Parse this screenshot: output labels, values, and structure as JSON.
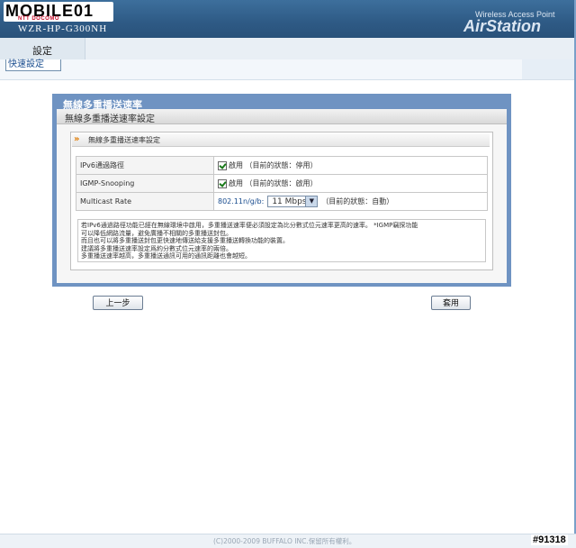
{
  "header": {
    "logo_text": "MOBILE01",
    "logo_sub": "NTT DOCOMO",
    "model": "WZR-HP-G300NH",
    "product_line": "Wireless Access Point",
    "brand": "AirStation"
  },
  "nav": {
    "tab_settings": "設定",
    "quick_setup": "快速設定"
  },
  "panel": {
    "title": "無線多重播送速率",
    "subtitle": "無線多重播送速率設定",
    "section_title": "無線多重播送速率設定",
    "rows": [
      {
        "label": "IPv6通過路徑",
        "check_label": "啟用",
        "status": "（目前的狀態：停用）"
      },
      {
        "label": "IGMP-Snooping",
        "check_label": "啟用",
        "status": "（目前的狀態：啟用）"
      },
      {
        "label": "Multicast Rate",
        "mode": "802.11n/g/b:",
        "rate_value": "11 Mbps",
        "status": "（目前的狀態：自動）"
      }
    ],
    "notes": [
      "若IPv6通過路徑功能已經在無線環境中啟用，多重播送速率便必須設定為比分數式位元速率更高的速率。 *IGMP竊探功能",
      "可以降低網路流量，避免廣播不相關的多重播送封包。",
      "而且也可以將多重播送封包更快速地傳送給支援多重播送轉換功能的裝置。",
      "建議將多重播送速率設定爲約分數式位元速率的兩倍。",
      "多重播送速率越高，多重播送通訊可用的通訊距離也會越短。"
    ]
  },
  "buttons": {
    "back": "上一步",
    "apply": "套用"
  },
  "footer": {
    "copyright": "(C)2000-2009 BUFFALO INC.保留所有權利。",
    "watermark": "#91318"
  },
  "colors": {
    "header_blue": "#2e5a85",
    "panel_blue": "#6f93c2",
    "accent_orange": "#e07a00"
  }
}
